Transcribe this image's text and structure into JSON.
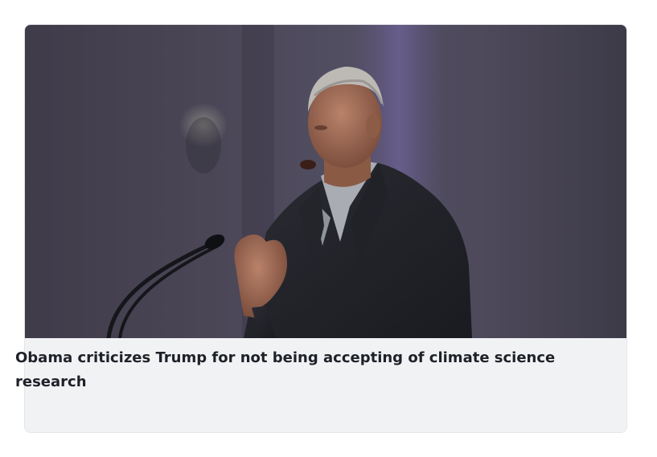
{
  "article": {
    "headline": "Obama criticizes Trump for not being accepting of climate science research",
    "image": {
      "subject": "speaker-at-microphone"
    }
  },
  "colors": {
    "caption_background": "#f1f2f4",
    "headline_text": "#1e2128",
    "photo_background": "#4a4656"
  }
}
